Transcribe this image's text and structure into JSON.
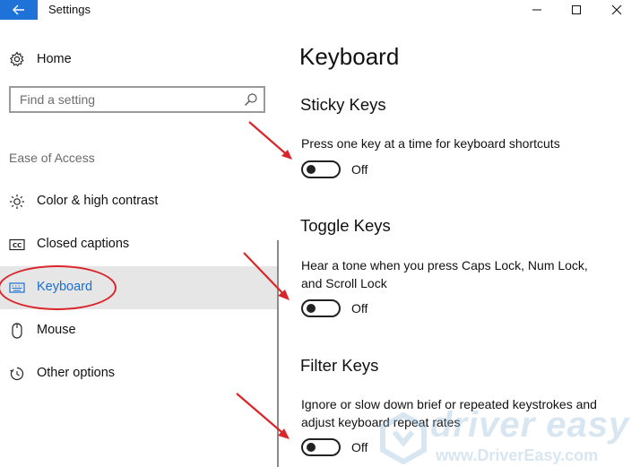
{
  "window": {
    "title": "Settings"
  },
  "sidebar": {
    "home_label": "Home",
    "search_placeholder": "Find a setting",
    "section_label": "Ease of Access",
    "items": [
      {
        "label": "Color & high contrast",
        "icon": "brightness-icon"
      },
      {
        "label": "Closed captions",
        "icon": "closed-captions-icon"
      },
      {
        "label": "Keyboard",
        "icon": "keyboard-icon",
        "selected": true
      },
      {
        "label": "Mouse",
        "icon": "mouse-icon"
      },
      {
        "label": "Other options",
        "icon": "other-options-icon"
      }
    ]
  },
  "main": {
    "title": "Keyboard",
    "sections": [
      {
        "title": "Sticky Keys",
        "description": "Press one key at a time for keyboard shortcuts",
        "toggle_state": "Off"
      },
      {
        "title": "Toggle Keys",
        "description": "Hear a tone when you press Caps Lock, Num Lock, and Scroll Lock",
        "toggle_state": "Off"
      },
      {
        "title": "Filter Keys",
        "description": "Ignore or slow down brief or repeated keystrokes and adjust keyboard repeat rates",
        "toggle_state": "Off"
      }
    ]
  },
  "watermark": {
    "brand": "driver easy",
    "url": "www.DriverEasy.com"
  },
  "colors": {
    "accent": "#1f73d8",
    "annotation": "#d9262a",
    "selected_bg": "#e6e6e6"
  }
}
